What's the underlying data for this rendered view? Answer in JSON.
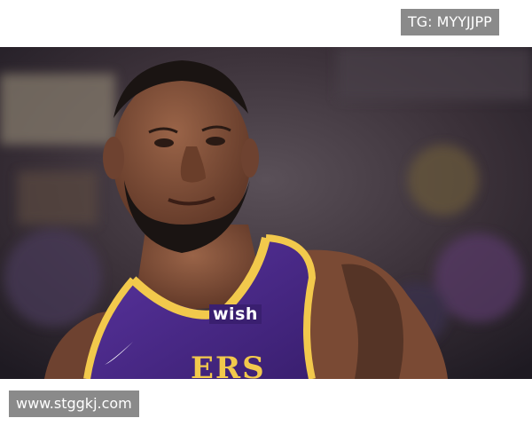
{
  "watermarks": {
    "top": "TG: MYYJJPP",
    "bottom": "www.stggkj.com"
  },
  "photo": {
    "subject": "basketball player in purple jersey, smiling, arena background",
    "jersey_texts": {
      "sponsor": "wish",
      "team": "ERS"
    },
    "colors": {
      "jersey_purple": "#4b2a8a",
      "jersey_gold": "#f2c94c",
      "skin": "#7a4a34",
      "beard": "#1a1412",
      "background_dark": "#2a2430"
    }
  }
}
